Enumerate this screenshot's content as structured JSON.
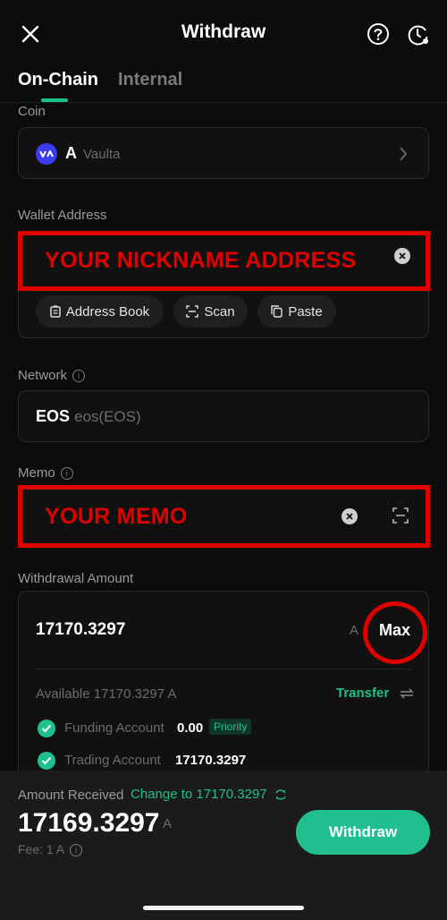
{
  "header": {
    "title": "Withdraw"
  },
  "tabs": [
    {
      "label": "On-Chain",
      "active": true
    },
    {
      "label": "Internal",
      "active": false
    }
  ],
  "coin": {
    "label": "Coin",
    "symbol": "A",
    "name": "Vaulta"
  },
  "wallet_address": {
    "label": "Wallet Address",
    "value": "YOUR NICKNAME ADDRESS",
    "buttons": [
      "Address Book",
      "Scan",
      "Paste"
    ]
  },
  "network": {
    "label": "Network",
    "symbol": "EOS",
    "name": "eos(EOS)"
  },
  "memo": {
    "label": "Memo",
    "value": "YOUR MEMO"
  },
  "amount": {
    "label": "Withdrawal Amount",
    "value": "17170.3297",
    "unit": "A",
    "max_label": "Max",
    "available": "Available 17170.3297 A",
    "transfer_label": "Transfer",
    "accounts": [
      {
        "name": "Funding Account",
        "value": "0.00",
        "badge": "Priority"
      },
      {
        "name": "Trading Account",
        "value": "17170.3297",
        "badge": ""
      }
    ]
  },
  "footer": {
    "received_label": "Amount Received",
    "change_link": "Change to 17170.3297",
    "received_value": "17169.3297",
    "received_unit": "A",
    "fee": "Fee: 1 A",
    "withdraw_button": "Withdraw"
  },
  "colors": {
    "accent": "#1fbf8f",
    "highlight": "#e00000",
    "background": "#0c0c0c"
  }
}
